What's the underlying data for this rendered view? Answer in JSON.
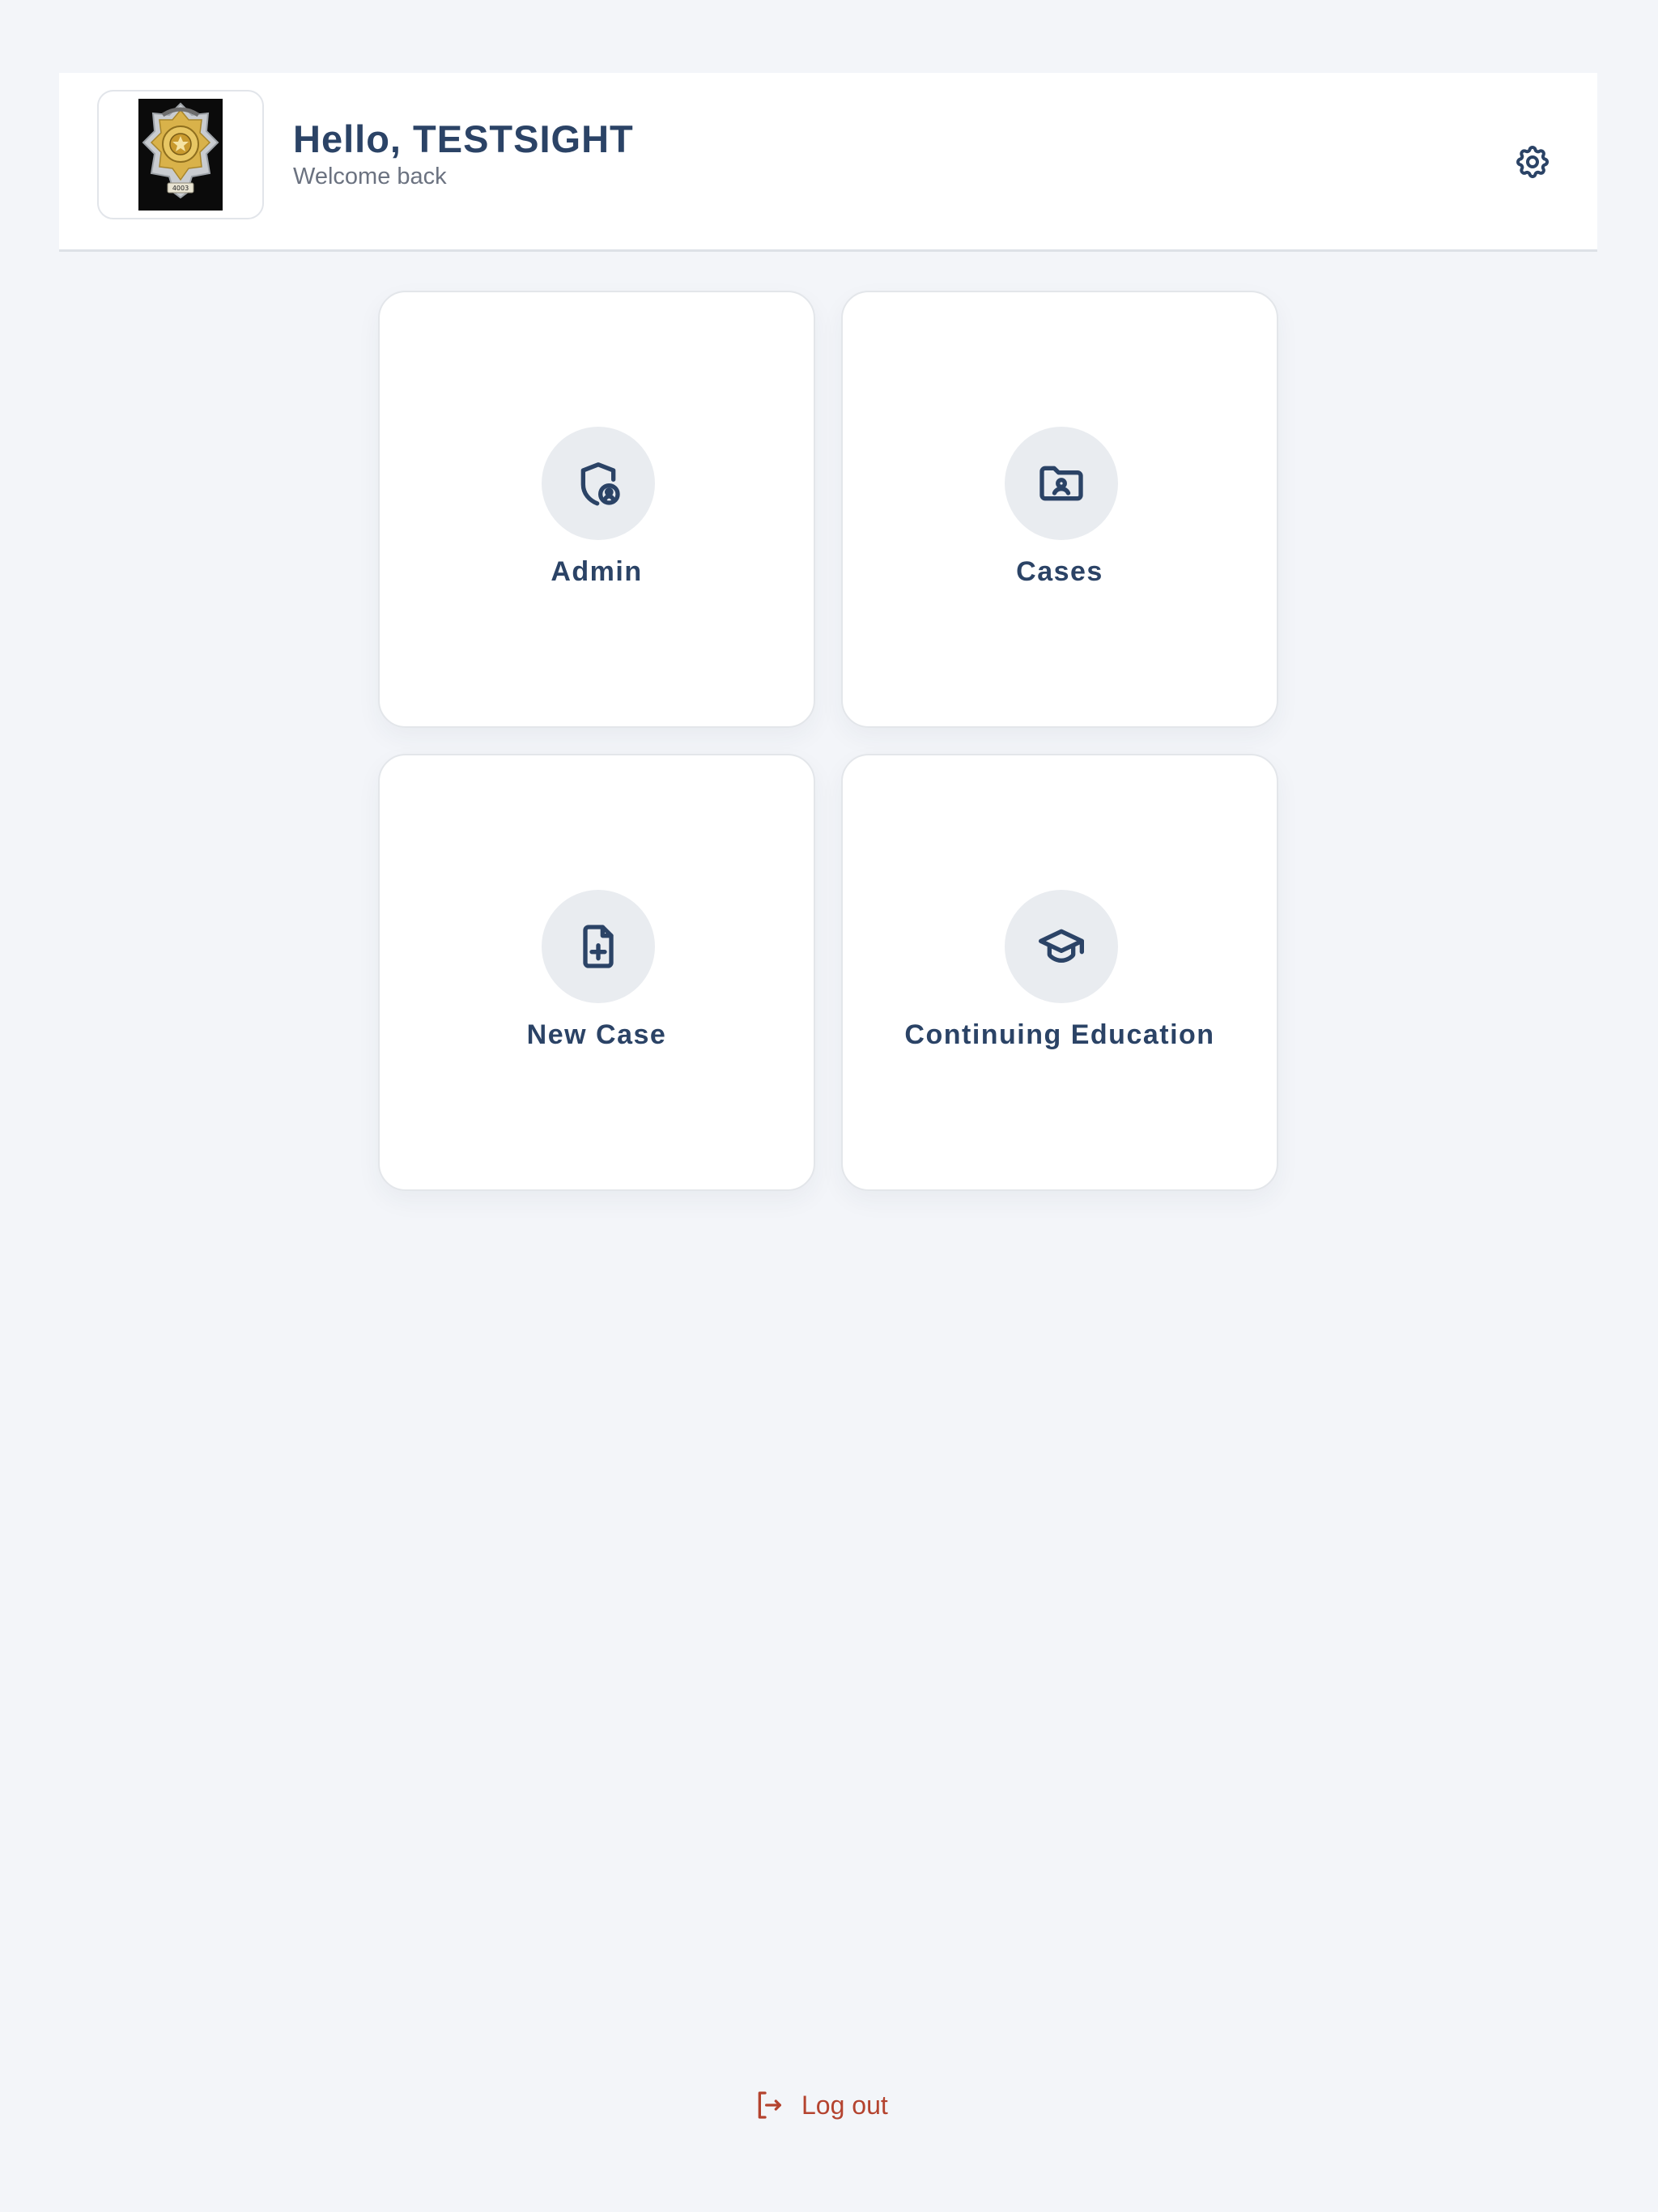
{
  "header": {
    "greeting": "Hello, TESTSIGHT",
    "subtitle": "Welcome back",
    "logo_badge_number": "4003",
    "logo_icon": "sheriff-badge-logo",
    "settings_icon": "gear-icon"
  },
  "tiles": [
    {
      "label": "Admin",
      "icon": "shield-user-icon"
    },
    {
      "label": "Cases",
      "icon": "folder-user-icon"
    },
    {
      "label": "New Case",
      "icon": "file-plus-icon"
    },
    {
      "label": "Continuing Education",
      "icon": "graduation-cap-icon"
    }
  ],
  "footer": {
    "logout_label": "Log out",
    "logout_icon": "logout-icon"
  },
  "colors": {
    "background": "#f3f5f9",
    "primary_text": "#2b4366",
    "muted_text": "#6b7280",
    "icon_circle": "#e9ecf0",
    "logout": "#b4432f"
  }
}
